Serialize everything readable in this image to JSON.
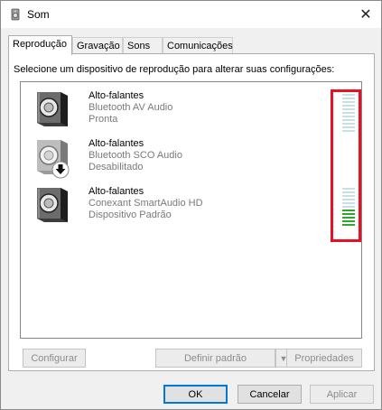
{
  "window": {
    "title": "Som",
    "close_glyph": "✕"
  },
  "tabs": [
    {
      "label": "Reprodução",
      "active": true
    },
    {
      "label": "Gravação",
      "active": false
    },
    {
      "label": "Sons",
      "active": false
    },
    {
      "label": "Comunicações",
      "active": false
    }
  ],
  "panel": {
    "instruction": "Selecione um dispositivo de reprodução para alterar suas configurações:"
  },
  "devices": [
    {
      "name": "Alto-falantes",
      "driver": "Bluetooth AV Audio",
      "status": "Pronta",
      "icon": "speaker-icon",
      "meter_level": 0
    },
    {
      "name": "Alto-falantes",
      "driver": "Bluetooth SCO Audio",
      "status": "Desabilitado",
      "icon": "speaker-disabled-icon"
    },
    {
      "name": "Alto-falantes",
      "driver": "Conexant SmartAudio HD",
      "status": "Dispositivo Padrão",
      "icon": "speaker-icon",
      "meter_level": 0.45
    }
  ],
  "buttons": {
    "configure": "Configurar",
    "set_default": "Definir padrão",
    "properties": "Propriedades",
    "ok": "OK",
    "cancel": "Cancelar",
    "apply": "Aplicar"
  },
  "colors": {
    "highlight_border": "#e81123",
    "meter_on": "#2da82a",
    "meter_off": "#c9dfe6"
  }
}
